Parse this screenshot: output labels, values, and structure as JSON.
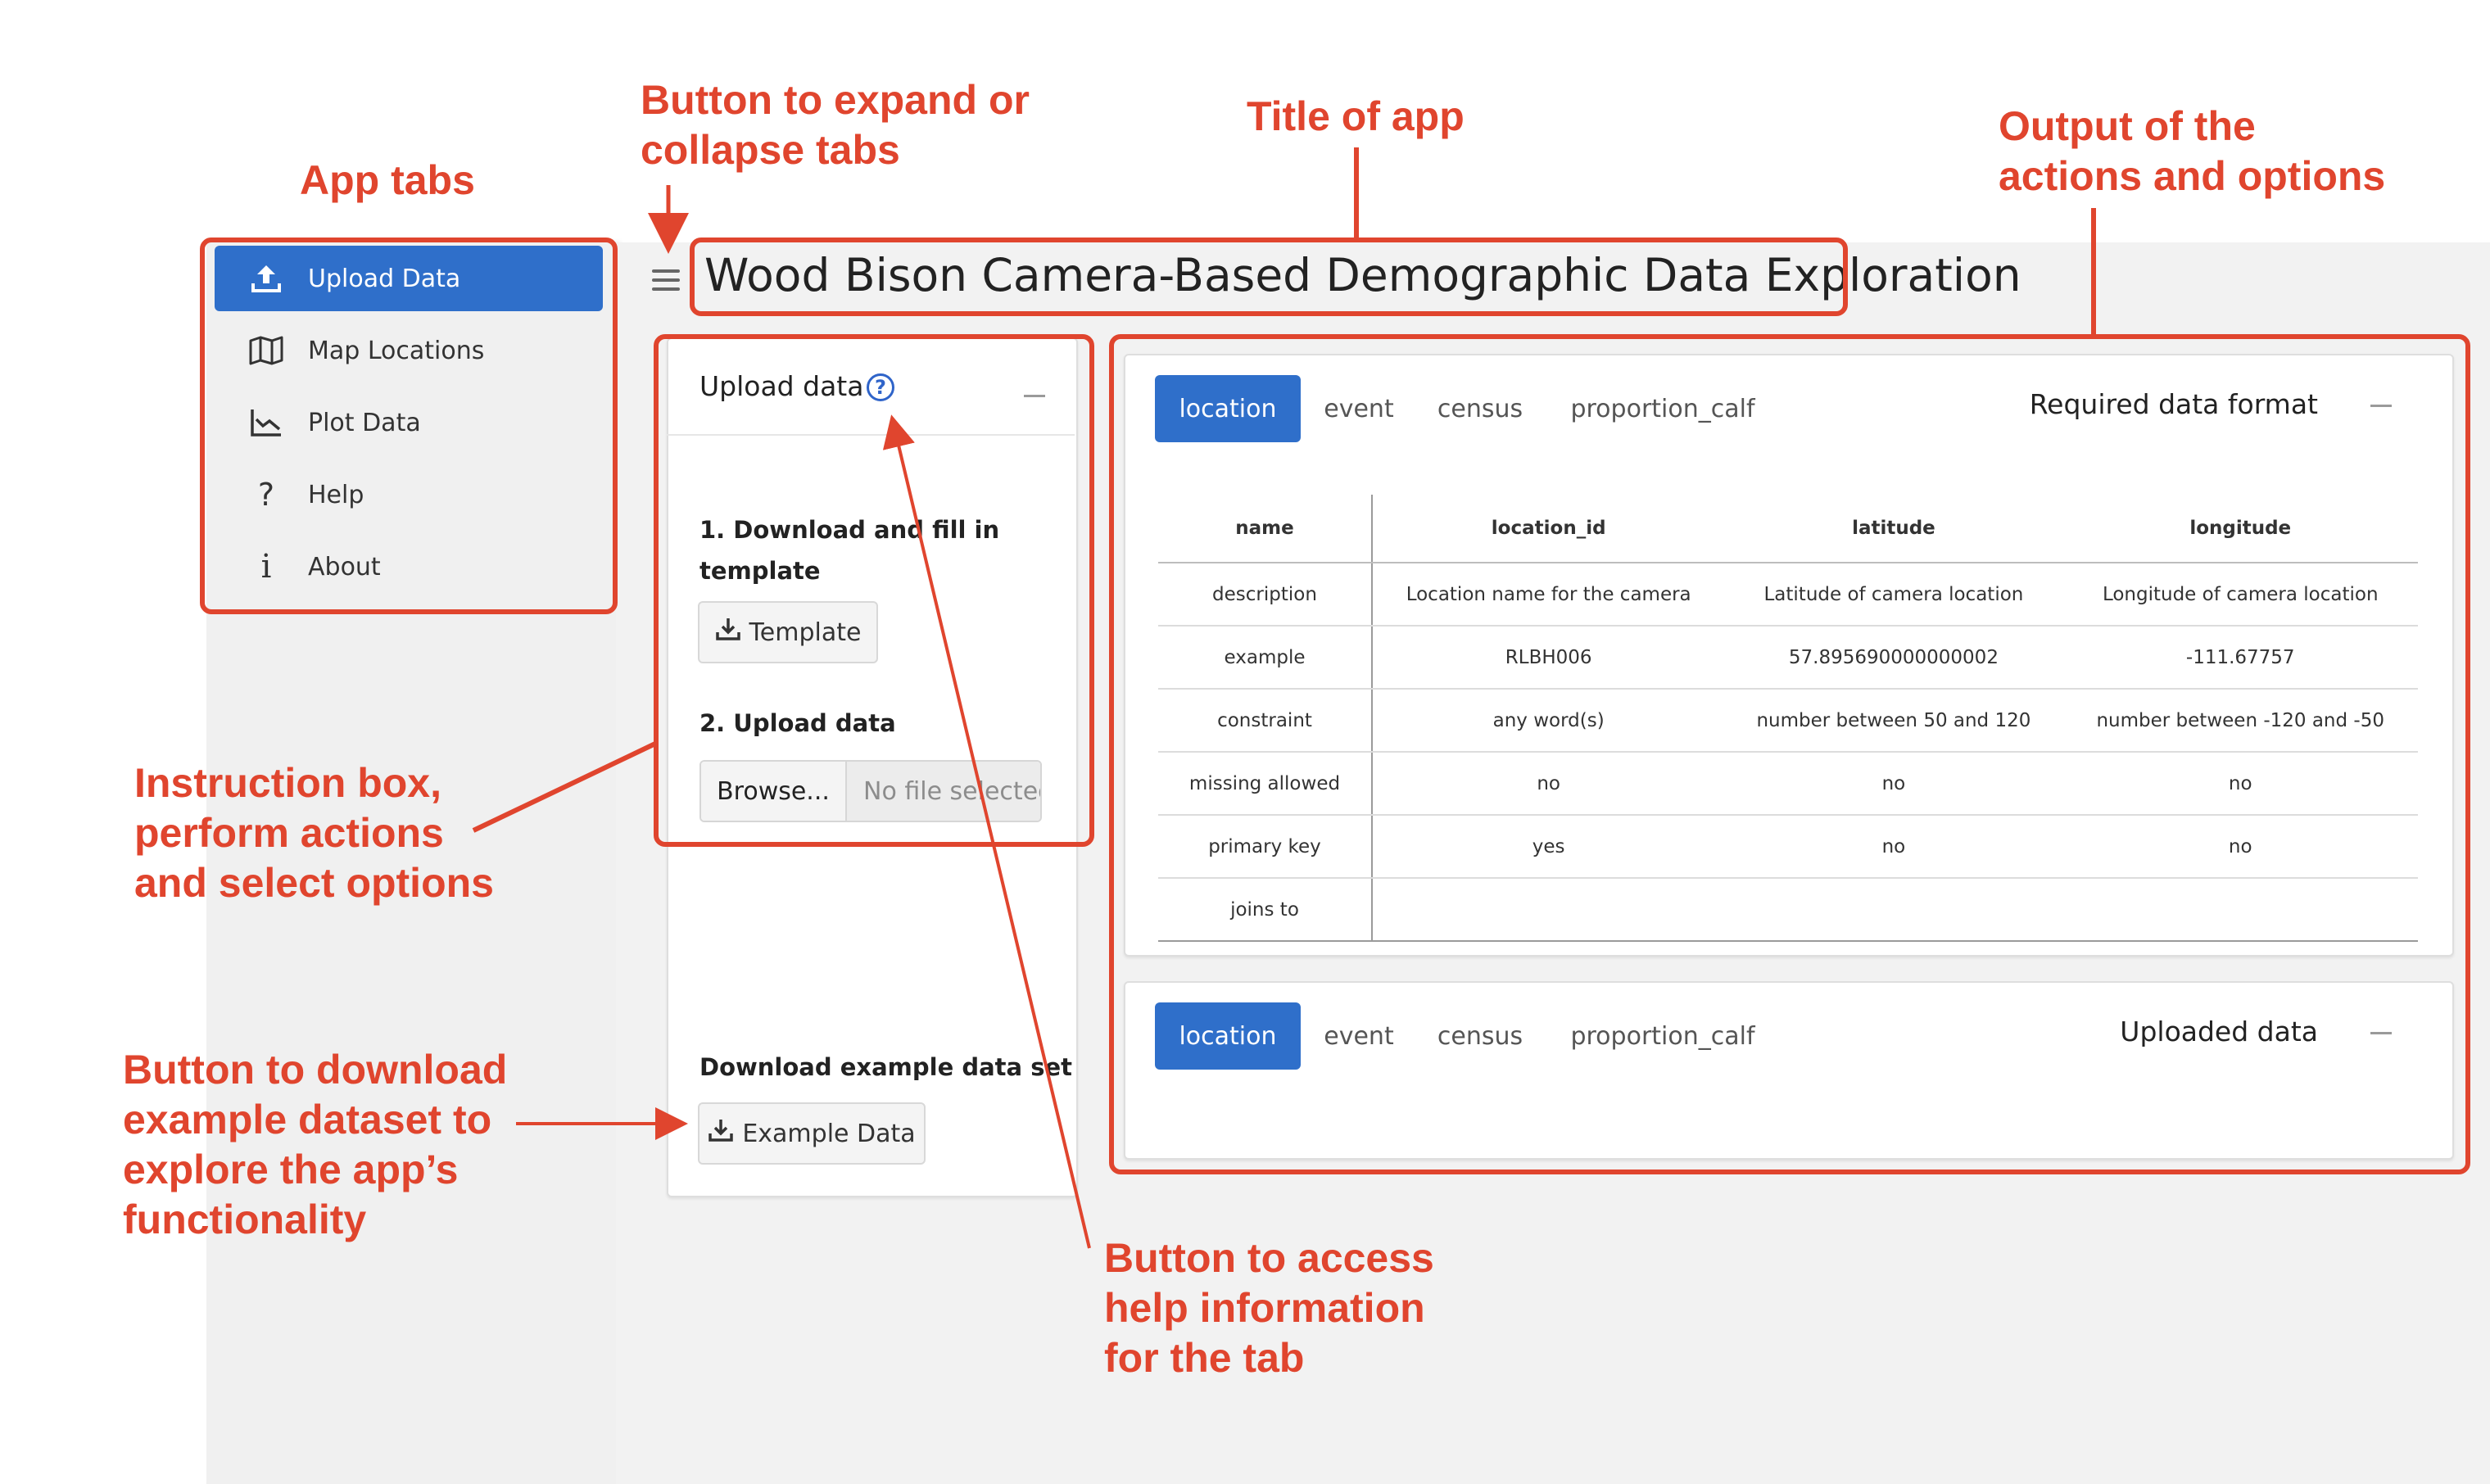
{
  "app": {
    "title": "Wood Bison Camera-Based Demographic Data Exploration"
  },
  "colors": {
    "primary": "#2f6fca",
    "annotation": "#e0452e",
    "sidebar_bg": "#f0f0f0",
    "main_bg": "#f2f2f2"
  },
  "sidebar": {
    "items": [
      {
        "label": "Upload Data",
        "icon": "upload-icon",
        "active": true
      },
      {
        "label": "Map Locations",
        "icon": "map-icon",
        "active": false
      },
      {
        "label": "Plot Data",
        "icon": "line-chart-icon",
        "active": false
      },
      {
        "label": "Help",
        "icon": "question-icon",
        "active": false
      },
      {
        "label": "About",
        "icon": "info-icon",
        "active": false
      }
    ]
  },
  "instructions": {
    "title": "Upload data",
    "step1": "1. Download and fill in template",
    "template_button": "Template",
    "step2": "2. Upload data",
    "browse_button": "Browse...",
    "file_status": "No file selected",
    "example_heading": "Download example data set",
    "example_button": "Example Data"
  },
  "format_card": {
    "title": "Required data format",
    "tabs": [
      "location",
      "event",
      "census",
      "proportion_calf"
    ],
    "active_tab": "location",
    "table": {
      "headers": [
        "name",
        "location_id",
        "latitude",
        "longitude"
      ],
      "rows": [
        [
          "description",
          "Location name for the camera",
          "Latitude of camera location",
          "Longitude of camera location"
        ],
        [
          "example",
          "RLBH006",
          "57.895690000000002",
          "-111.67757"
        ],
        [
          "constraint",
          "any word(s)",
          "number between 50 and 120",
          "number between -120 and -50"
        ],
        [
          "missing allowed",
          "no",
          "no",
          "no"
        ],
        [
          "primary key",
          "yes",
          "no",
          "no"
        ],
        [
          "joins to",
          "",
          "",
          ""
        ]
      ]
    }
  },
  "uploaded_card": {
    "title": "Uploaded data",
    "tabs": [
      "location",
      "event",
      "census",
      "proportion_calf"
    ],
    "active_tab": "location"
  },
  "annotations": {
    "app_tabs": "App tabs",
    "expand_collapse": [
      "Button to expand or",
      "collapse tabs"
    ],
    "title_of_app": "Title of app",
    "output": [
      "Output of the",
      "actions and options"
    ],
    "instruction_box": [
      "Instruction box,",
      "perform actions",
      "and select options"
    ],
    "download_example": [
      "Button to download",
      "example dataset to",
      "explore the app’s",
      "functionality"
    ],
    "help_button": [
      "Button to access",
      "help information",
      "for the tab"
    ]
  }
}
